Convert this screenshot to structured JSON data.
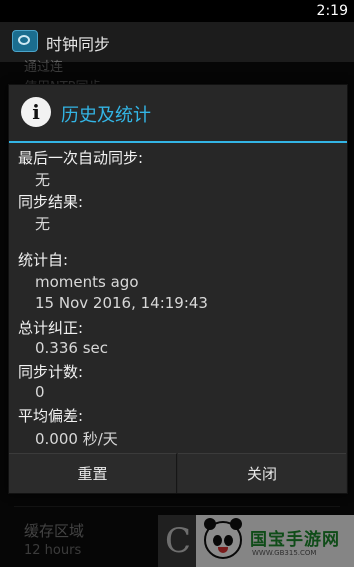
{
  "status_bar": {
    "time": "2:19"
  },
  "action_bar": {
    "title": "时钟同步"
  },
  "background": {
    "fragments": [
      "通过连",
      "使用NTP同步"
    ],
    "items": [
      {
        "title": "缓存区域",
        "subtitle": "12 hours"
      }
    ]
  },
  "watermark": {
    "letter": "C",
    "brand_name": "国宝手游网",
    "url": "WWW.GB315.COM"
  },
  "dialog": {
    "title": "历史及统计",
    "info_glyph": "i",
    "rows": [
      {
        "label": "最后一次自动同步:",
        "values": [
          "无"
        ]
      },
      {
        "label": "同步结果:",
        "values": [
          "无"
        ]
      },
      {
        "label": "统计自:",
        "values": [
          "moments ago",
          "15 Nov 2016, 14:19:43"
        ]
      },
      {
        "label": "总计纠正:",
        "values": [
          "0.336 sec"
        ]
      },
      {
        "label": "同步计数:",
        "values": [
          "0"
        ]
      },
      {
        "label": "平均偏差:",
        "values": [
          "0.000 秒/天"
        ]
      }
    ],
    "buttons": {
      "reset": "重置",
      "close": "关闭"
    }
  },
  "colors": {
    "accent": "#33b5e5",
    "dialog_bg": "#272727",
    "app_bg": "#0b0b0b"
  }
}
